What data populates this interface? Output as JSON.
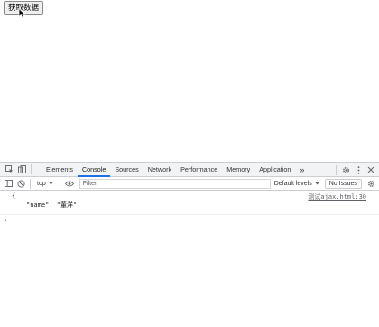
{
  "page": {
    "button_label": "获取数据"
  },
  "devtools": {
    "tabs": [
      {
        "label": "Elements"
      },
      {
        "label": "Console"
      },
      {
        "label": "Sources"
      },
      {
        "label": "Network"
      },
      {
        "label": "Performance"
      },
      {
        "label": "Memory"
      },
      {
        "label": "Application"
      }
    ],
    "more_tabs": "»",
    "toolbar": {
      "context": "top",
      "filter_placeholder": "Filter",
      "levels": "Default levels",
      "issues": "No Issues"
    },
    "console": {
      "entry_open": "{",
      "entry_key": "\"name\"",
      "entry_sep": ": ",
      "entry_value": "\"董洋\"",
      "entry_source": "测试ajax.html:30",
      "prompt": "›"
    }
  },
  "colors": {
    "accent": "#1a73e8",
    "tabbar_bg": "#f1f3f4",
    "border": "#cbcdd1"
  }
}
